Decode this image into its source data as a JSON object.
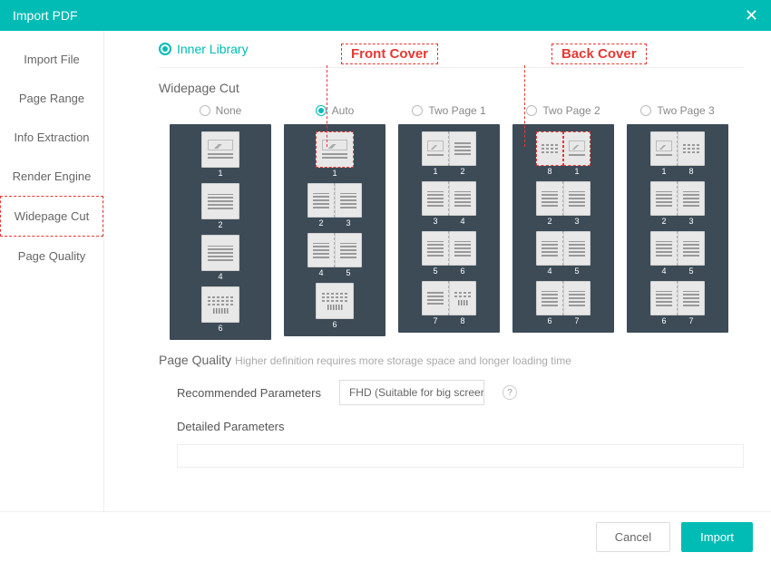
{
  "header": {
    "title": "Import PDF",
    "close": "✕"
  },
  "sidebar": {
    "items": [
      {
        "label": "Import File"
      },
      {
        "label": "Page Range"
      },
      {
        "label": "Info Extraction"
      },
      {
        "label": "Render Engine"
      },
      {
        "label": "Widepage Cut"
      },
      {
        "label": "Page Quality"
      }
    ]
  },
  "annotations": {
    "front": "Front Cover",
    "back": "Back Cover"
  },
  "inner": {
    "label": "Inner Library"
  },
  "widepage": {
    "title": "Widepage Cut",
    "options": [
      "None",
      "Auto",
      "Two Page 1",
      "Two Page 2",
      "Two Page 3"
    ],
    "selected": "Auto",
    "previews": {
      "none": [
        [
          "1"
        ],
        [
          "2"
        ],
        [
          "4"
        ],
        [
          "6"
        ]
      ],
      "auto": [
        [
          "1"
        ],
        [
          "2",
          "3"
        ],
        [
          "4",
          "5"
        ],
        [
          "6"
        ]
      ],
      "tp1": [
        [
          "1",
          "2"
        ],
        [
          "3",
          "4"
        ],
        [
          "5",
          "6"
        ],
        [
          "7",
          "8"
        ]
      ],
      "tp2": [
        [
          "8",
          "1"
        ],
        [
          "2",
          "3"
        ],
        [
          "4",
          "5"
        ],
        [
          "6",
          "7"
        ]
      ],
      "tp3": [
        [
          "1",
          "8"
        ],
        [
          "2",
          "3"
        ],
        [
          "4",
          "5"
        ],
        [
          "6",
          "7"
        ]
      ]
    }
  },
  "quality": {
    "title": "Page Quality",
    "hint": "Higher definition requires more storage space and longer loading time",
    "rec_label": "Recommended Parameters",
    "rec_value": "FHD (Suitable for big screen",
    "detailed_label": "Detailed Parameters"
  },
  "footer": {
    "cancel": "Cancel",
    "import": "Import"
  }
}
